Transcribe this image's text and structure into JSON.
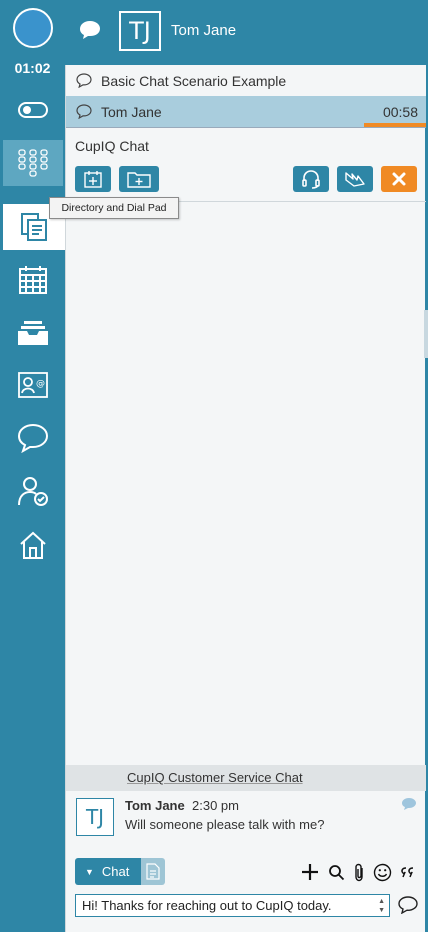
{
  "rail": {
    "timer": "01:02",
    "items": [
      {
        "name": "toggle-icon"
      },
      {
        "name": "dialpad-icon"
      },
      {
        "name": "documents-icon"
      },
      {
        "name": "calendar-icon"
      },
      {
        "name": "inbox-icon"
      },
      {
        "name": "contact-card-icon"
      },
      {
        "name": "chat-icon"
      },
      {
        "name": "user-check-icon"
      },
      {
        "name": "home-icon"
      }
    ]
  },
  "header": {
    "initials": "TJ",
    "name": "Tom Jane"
  },
  "conversations": [
    {
      "label": "Basic Chat Scenario Example"
    },
    {
      "label": "Tom Jane",
      "time": "00:58",
      "progress": 1.0
    }
  ],
  "section": {
    "title": "CupIQ Chat"
  },
  "tooltip": "Directory and Dial Pad",
  "chat": {
    "header": "CupIQ Customer Service Chat",
    "messages": [
      {
        "initials": "TJ",
        "author": "Tom Jane",
        "time": "2:30 pm",
        "text": "Will someone please talk with me?"
      }
    ],
    "mode_label": "Chat",
    "input_value": "Hi! Thanks for reaching out to CupIQ today."
  },
  "colors": {
    "primary": "#2e86a6",
    "accent": "#f08a24",
    "selected_row": "#a9cddd"
  }
}
